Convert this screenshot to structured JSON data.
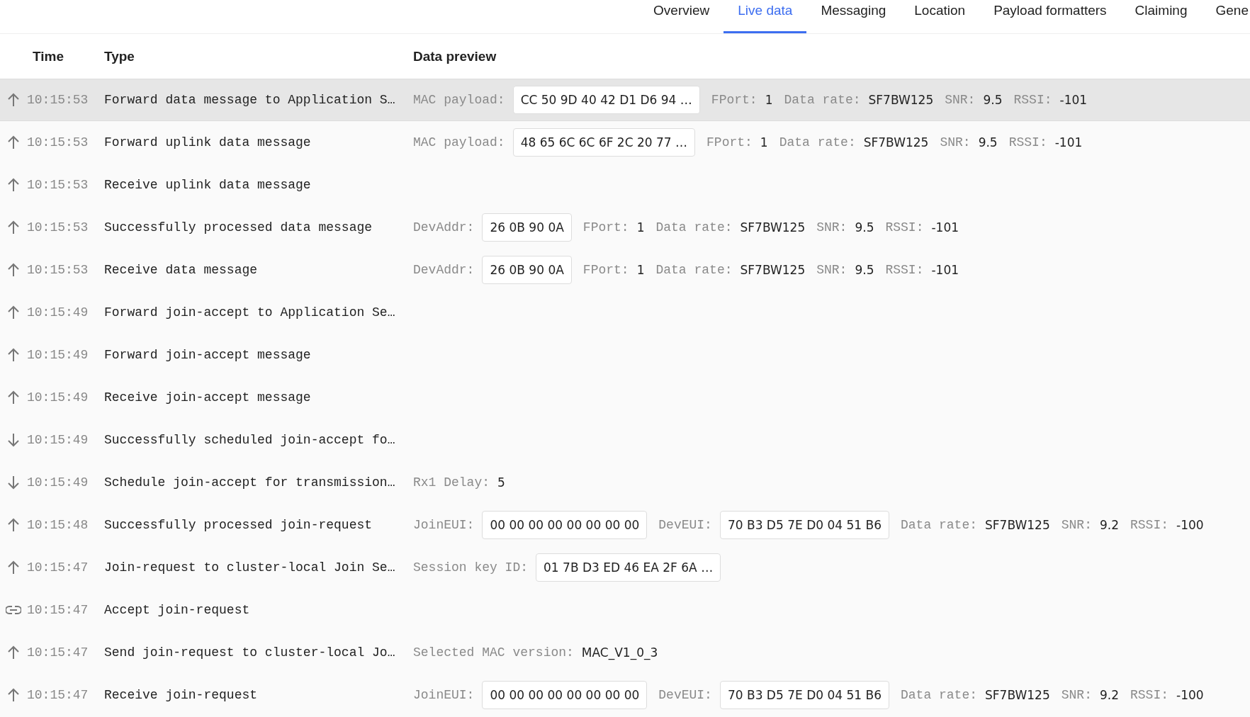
{
  "tabs": [
    {
      "label": "Overview",
      "selected": false
    },
    {
      "label": "Live data",
      "selected": true
    },
    {
      "label": "Messaging",
      "selected": false
    },
    {
      "label": "Location",
      "selected": false
    },
    {
      "label": "Payload formatters",
      "selected": false
    },
    {
      "label": "Claiming",
      "selected": false
    },
    {
      "label": "Gene",
      "selected": false
    }
  ],
  "table": {
    "columns": [
      "Time",
      "Type",
      "Data preview"
    ],
    "rows": [
      {
        "kind": "up",
        "highlighted": true,
        "time": "10:15:53",
        "type": "Forward data message to Application S…",
        "preview": [
          {
            "kind": "box",
            "label": "MAC payload:",
            "value": "CC 50 9D 40 42 D1 D6 94 …"
          },
          {
            "kind": "plain",
            "label": "FPort:",
            "value": "1"
          },
          {
            "kind": "plain",
            "label": "Data rate:",
            "value": "SF7BW125"
          },
          {
            "kind": "plain",
            "label": "SNR:",
            "value": "9.5"
          },
          {
            "kind": "plain",
            "label": "RSSI:",
            "value": "-101"
          }
        ]
      },
      {
        "kind": "up",
        "highlighted": false,
        "time": "10:15:53",
        "type": "Forward uplink data message",
        "preview": [
          {
            "kind": "box",
            "label": "MAC payload:",
            "value": "48 65 6C 6C 6F 2C 20 77 …"
          },
          {
            "kind": "plain",
            "label": "FPort:",
            "value": "1"
          },
          {
            "kind": "plain",
            "label": "Data rate:",
            "value": "SF7BW125"
          },
          {
            "kind": "plain",
            "label": "SNR:",
            "value": "9.5"
          },
          {
            "kind": "plain",
            "label": "RSSI:",
            "value": "-101"
          }
        ]
      },
      {
        "kind": "up",
        "highlighted": false,
        "time": "10:15:53",
        "type": "Receive uplink data message",
        "preview": []
      },
      {
        "kind": "up",
        "highlighted": false,
        "time": "10:15:53",
        "type": "Successfully processed data message",
        "preview": [
          {
            "kind": "box",
            "label": "DevAddr:",
            "value": "26 0B 90 0A"
          },
          {
            "kind": "plain",
            "label": "FPort:",
            "value": "1"
          },
          {
            "kind": "plain",
            "label": "Data rate:",
            "value": "SF7BW125"
          },
          {
            "kind": "plain",
            "label": "SNR:",
            "value": "9.5"
          },
          {
            "kind": "plain",
            "label": "RSSI:",
            "value": "-101"
          }
        ]
      },
      {
        "kind": "up",
        "highlighted": false,
        "time": "10:15:53",
        "type": "Receive data message",
        "preview": [
          {
            "kind": "box",
            "label": "DevAddr:",
            "value": "26 0B 90 0A"
          },
          {
            "kind": "plain",
            "label": "FPort:",
            "value": "1"
          },
          {
            "kind": "plain",
            "label": "Data rate:",
            "value": "SF7BW125"
          },
          {
            "kind": "plain",
            "label": "SNR:",
            "value": "9.5"
          },
          {
            "kind": "plain",
            "label": "RSSI:",
            "value": "-101"
          }
        ]
      },
      {
        "kind": "up",
        "highlighted": false,
        "time": "10:15:49",
        "type": "Forward join-accept to Application Se…",
        "preview": []
      },
      {
        "kind": "up",
        "highlighted": false,
        "time": "10:15:49",
        "type": "Forward join-accept message",
        "preview": []
      },
      {
        "kind": "up",
        "highlighted": false,
        "time": "10:15:49",
        "type": "Receive join-accept message",
        "preview": []
      },
      {
        "kind": "down",
        "highlighted": false,
        "time": "10:15:49",
        "type": "Successfully scheduled join-accept fo…",
        "preview": []
      },
      {
        "kind": "down",
        "highlighted": false,
        "time": "10:15:49",
        "type": "Schedule join-accept for transmission…",
        "preview": [
          {
            "kind": "plain",
            "label": "Rx1 Delay:",
            "value": "5"
          }
        ]
      },
      {
        "kind": "up",
        "highlighted": false,
        "time": "10:15:48",
        "type": "Successfully processed join-request",
        "preview": [
          {
            "kind": "box",
            "label": "JoinEUI:",
            "value": "00 00 00 00 00 00 00 00"
          },
          {
            "kind": "box",
            "label": "DevEUI:",
            "value": "70 B3 D5 7E D0 04 51 B6"
          },
          {
            "kind": "plain",
            "label": "Data rate:",
            "value": "SF7BW125"
          },
          {
            "kind": "plain",
            "label": "SNR:",
            "value": "9.2"
          },
          {
            "kind": "plain",
            "label": "RSSI:",
            "value": "-100"
          }
        ]
      },
      {
        "kind": "up",
        "highlighted": false,
        "time": "10:15:47",
        "type": "Join-request to cluster-local Join Se…",
        "preview": [
          {
            "kind": "box",
            "label": "Session key ID:",
            "value": "01 7B D3 ED 46 EA 2F 6A …"
          }
        ]
      },
      {
        "kind": "link",
        "highlighted": false,
        "time": "10:15:47",
        "type": "Accept join-request",
        "preview": []
      },
      {
        "kind": "up",
        "highlighted": false,
        "time": "10:15:47",
        "type": "Send join-request to cluster-local Jo…",
        "preview": [
          {
            "kind": "plain",
            "label": "Selected MAC version:",
            "value": "MAC_V1_0_3"
          }
        ]
      },
      {
        "kind": "up",
        "highlighted": false,
        "time": "10:15:47",
        "type": "Receive join-request",
        "preview": [
          {
            "kind": "box",
            "label": "JoinEUI:",
            "value": "00 00 00 00 00 00 00 00"
          },
          {
            "kind": "box",
            "label": "DevEUI:",
            "value": "70 B3 D5 7E D0 04 51 B6"
          },
          {
            "kind": "plain",
            "label": "Data rate:",
            "value": "SF7BW125"
          },
          {
            "kind": "plain",
            "label": "SNR:",
            "value": "9.2"
          },
          {
            "kind": "plain",
            "label": "RSSI:",
            "value": "-100"
          }
        ]
      }
    ]
  }
}
